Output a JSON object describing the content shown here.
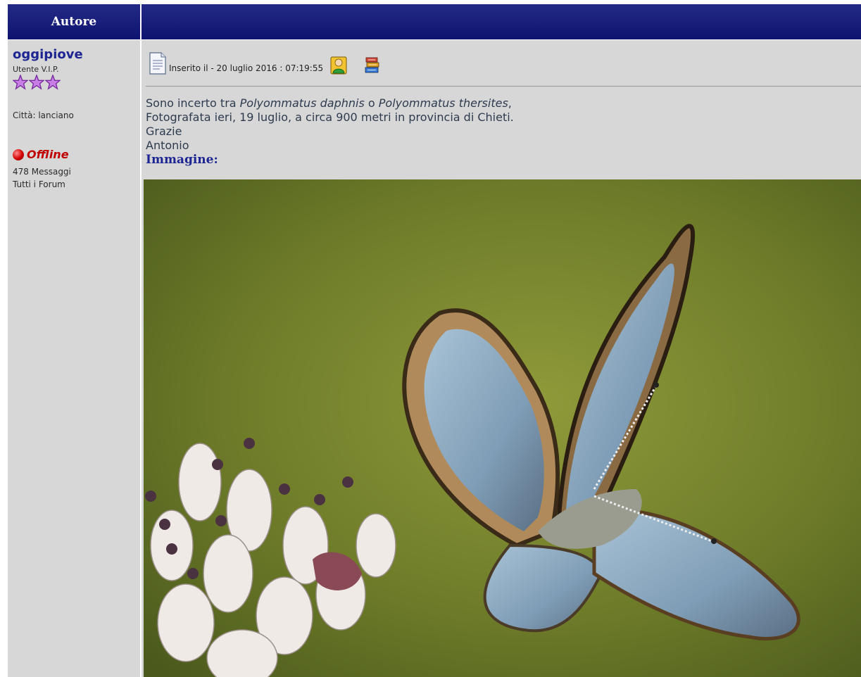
{
  "header": {
    "author_col_title": "Autore"
  },
  "author": {
    "name": "oggipiove",
    "rank": "Utente V.I.P.",
    "stars": 3,
    "city_label": "Città: lanciano",
    "status": "Offline",
    "messages": "478 Messaggi",
    "all_forums": "Tutti i Forum"
  },
  "post": {
    "posted_label": "Inserito il - 20 luglio 2016 : 07:19:55",
    "text_prefix": "Sono incerto tra ",
    "species1": "Polyommatus daphnis",
    "text_mid": " o ",
    "species2": "Polyommatus thersites",
    "text_suffix": ",",
    "line2": "Fotografata ieri, 19 luglio, a circa 900 metri in provincia di Chieti.",
    "line3": "Grazie",
    "line4": "Antonio",
    "image_label": "Immagine:"
  },
  "icons": [
    "document-icon",
    "profile-icon",
    "books-icon",
    "star-icon",
    "status-dot-icon"
  ],
  "colors": {
    "header_bg": "#151a78",
    "panel_bg": "#d7d7d7",
    "author_name": "#1d2592",
    "offline": "#c00000"
  }
}
